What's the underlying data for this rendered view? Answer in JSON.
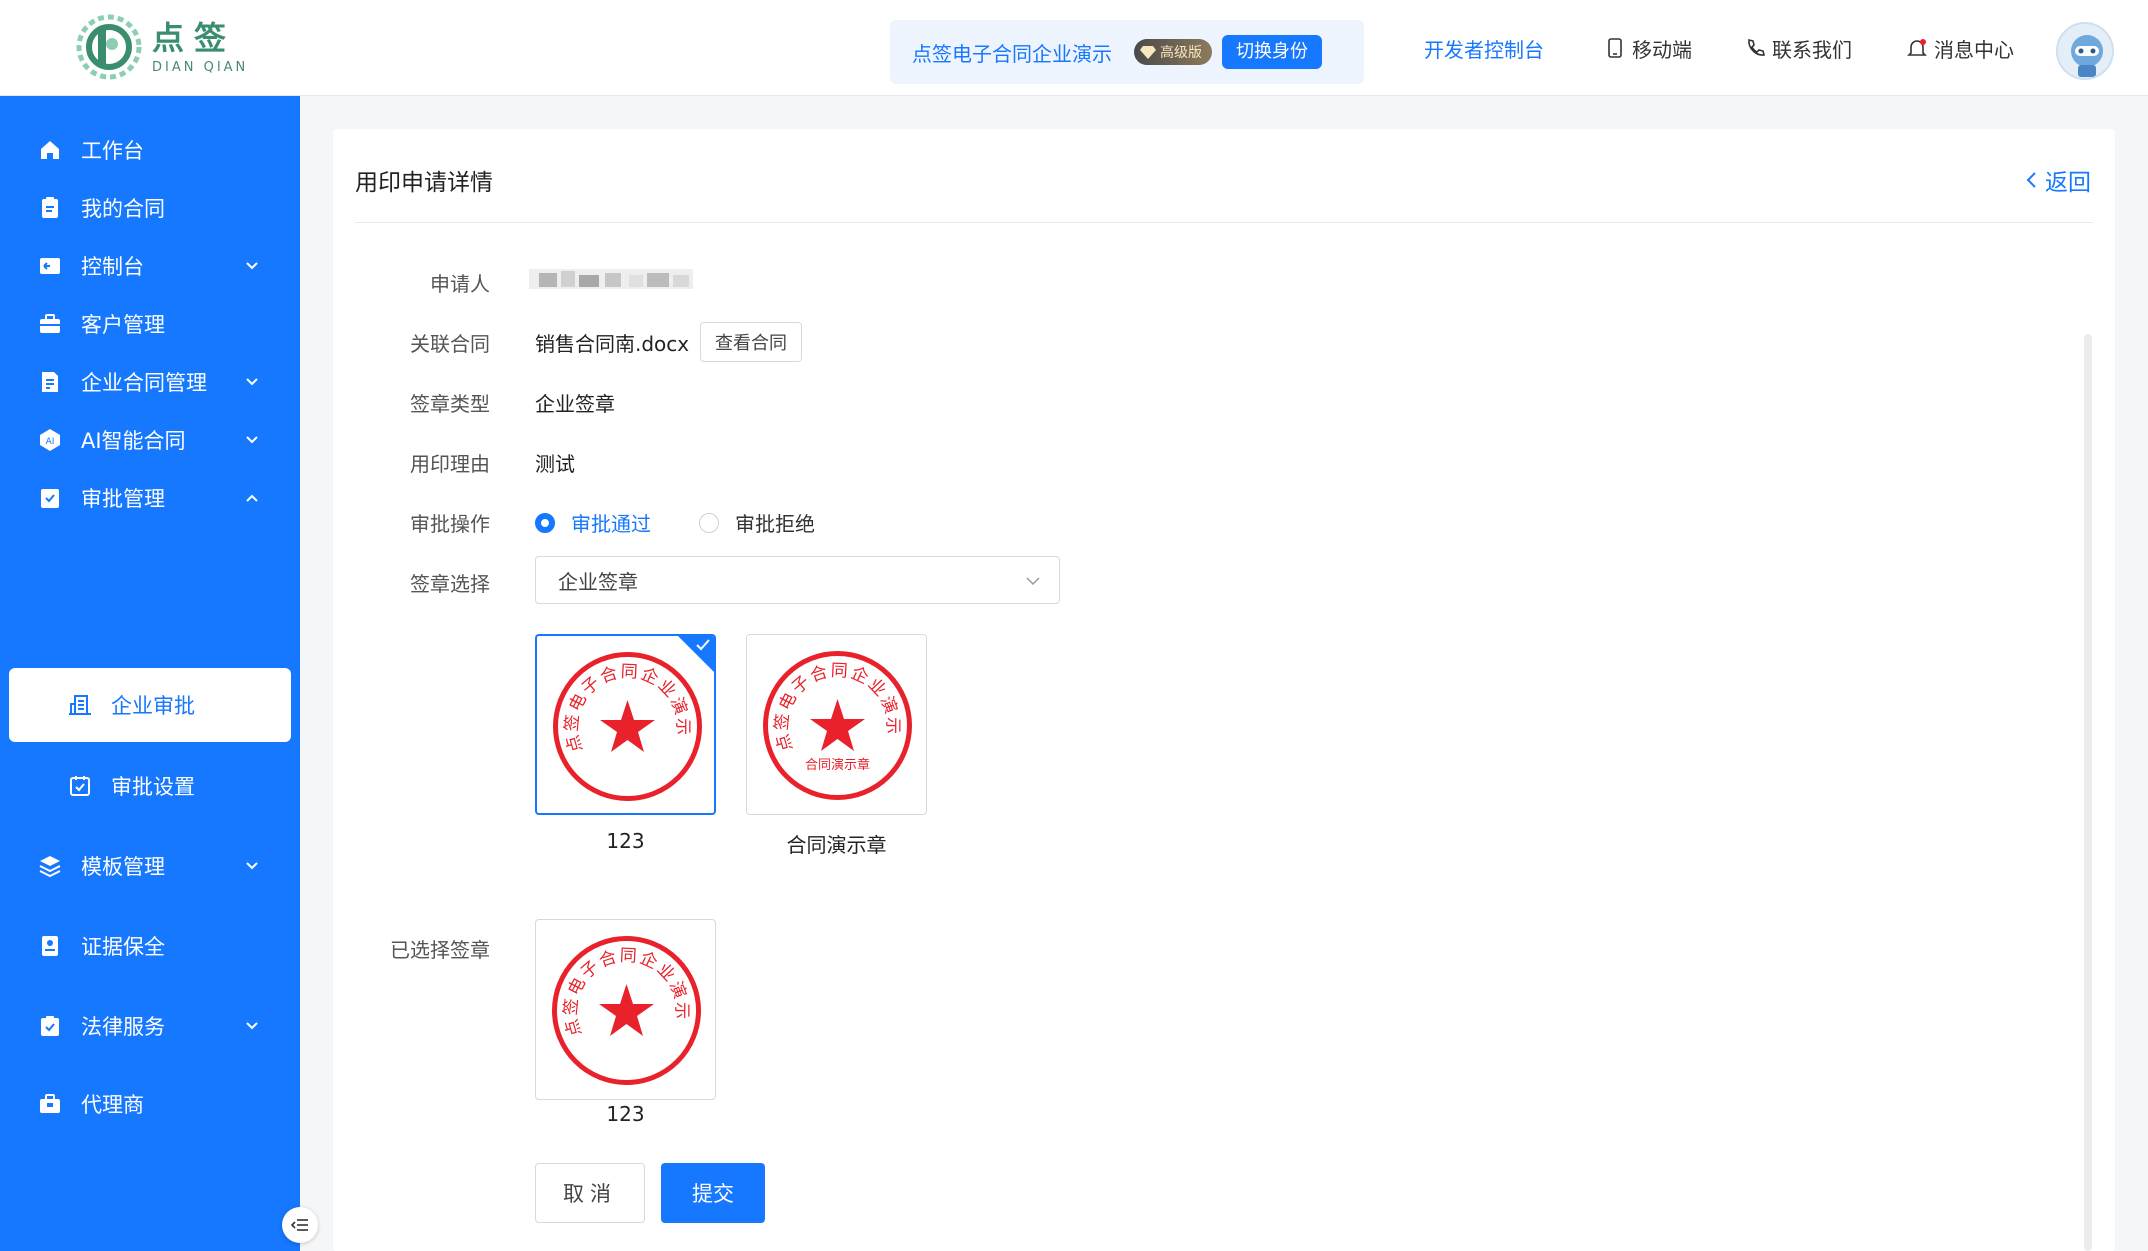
{
  "header": {
    "logo_cn": "点签",
    "logo_en": "DIAN QIAN",
    "account_name": "点签电子合同企业演示",
    "tier_badge": "高级版",
    "switch_button": "切换身份",
    "nav": {
      "developer": "开发者控制台",
      "mobile": "移动端",
      "contact": "联系我们",
      "messages": "消息中心"
    }
  },
  "sidebar": {
    "items": [
      {
        "label": "工作台",
        "icon": "home-icon"
      },
      {
        "label": "我的合同",
        "icon": "contract-icon"
      },
      {
        "label": "控制台",
        "icon": "console-icon",
        "expandable": true
      },
      {
        "label": "客户管理",
        "icon": "briefcase-icon"
      },
      {
        "label": "企业合同管理",
        "icon": "document-icon",
        "expandable": true
      },
      {
        "label": "AI智能合同",
        "icon": "ai-icon",
        "expandable": true
      },
      {
        "label": "审批管理",
        "icon": "approval-icon",
        "expanded": true
      },
      {
        "label": "企业审批",
        "icon": "building-icon",
        "active": true
      },
      {
        "label": "审批设置",
        "icon": "checkbox-icon"
      },
      {
        "label": "模板管理",
        "icon": "layers-icon",
        "expandable": true
      },
      {
        "label": "证据保全",
        "icon": "evidence-icon"
      },
      {
        "label": "法律服务",
        "icon": "legal-icon",
        "expandable": true
      },
      {
        "label": "代理商",
        "icon": "agent-icon"
      }
    ]
  },
  "page": {
    "title": "用印申请详情",
    "back": "返回"
  },
  "form": {
    "applicant_label": "申请人",
    "contract_label": "关联合同",
    "contract_value": "销售合同南.docx",
    "view_contract": "查看合同",
    "seal_type_label": "签章类型",
    "seal_type_value": "企业签章",
    "reason_label": "用印理由",
    "reason_value": "测试",
    "approval_label": "审批操作",
    "approve_option": "审批通过",
    "reject_option": "审批拒绝",
    "selected_option": "审批通过",
    "seal_select_label": "签章选择",
    "seal_select_value": "企业签章",
    "chosen_label": "已选择签章"
  },
  "seals": [
    {
      "name": "123",
      "ring_text": "点签电子合同企业演示",
      "inner_text": "",
      "selected": true
    },
    {
      "name": "合同演示章",
      "ring_text": "点签电子合同企业演示",
      "inner_text": "合同演示章",
      "selected": false
    }
  ],
  "chosen_seal": {
    "name": "123",
    "ring_text": "点签电子合同企业演示"
  },
  "buttons": {
    "cancel": "取消",
    "submit": "提交"
  },
  "colors": {
    "primary": "#1677ff",
    "seal_red": "#e8212b",
    "brand_green": "#3a8e6e"
  }
}
